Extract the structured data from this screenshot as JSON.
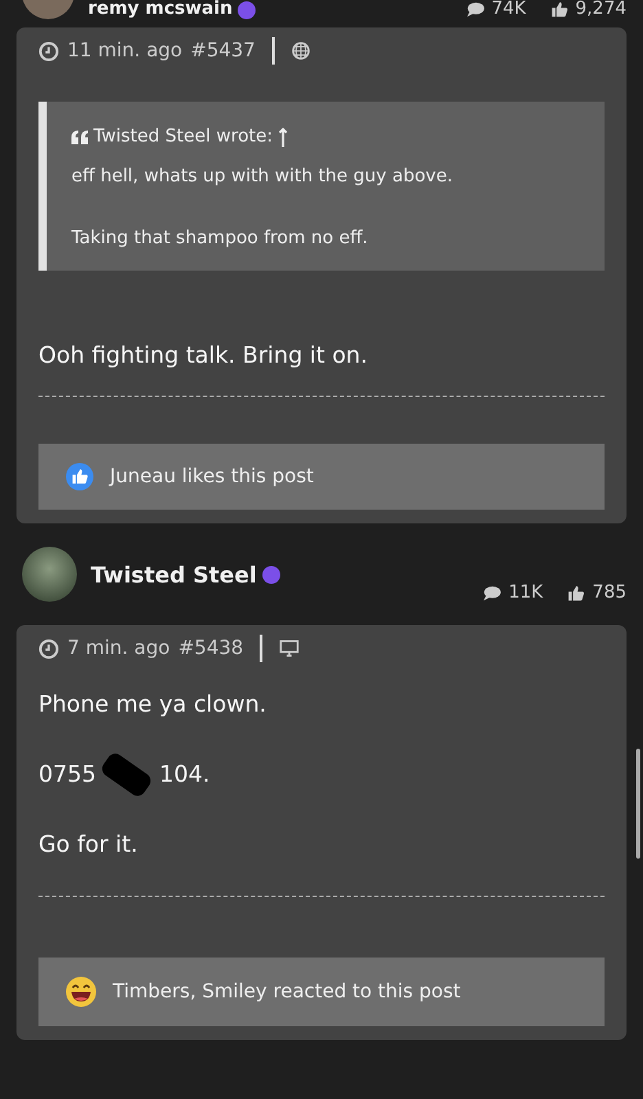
{
  "posts": [
    {
      "author": "remy mcswain",
      "comments": "74K",
      "likes": "9,274",
      "time": "11 min. ago",
      "number": "#5437",
      "device": {
        "kind": "globe"
      },
      "quote": {
        "author": "Twisted Steel wrote:",
        "paragraphs": [
          "eff hell, whats up with with the guy above.",
          "Taking that shampoo from no eff."
        ]
      },
      "body": [
        {
          "kind": "text",
          "text": "Ooh fighting talk. Bring it on."
        }
      ],
      "reaction": {
        "kind": "like",
        "text": "Juneau likes this post"
      }
    },
    {
      "author": "Twisted Steel",
      "comments": "11K",
      "likes": "785",
      "time": "7 min. ago",
      "number": "#5438",
      "device": {
        "kind": "desktop"
      },
      "body": [
        {
          "kind": "text",
          "text": "Phone me ya clown."
        },
        {
          "kind": "redacted",
          "before": "0755",
          "after": "104."
        },
        {
          "kind": "text",
          "text": "Go for it."
        }
      ],
      "reaction": {
        "kind": "laugh",
        "text": "Timbers, Smiley reacted to this post"
      }
    }
  ]
}
